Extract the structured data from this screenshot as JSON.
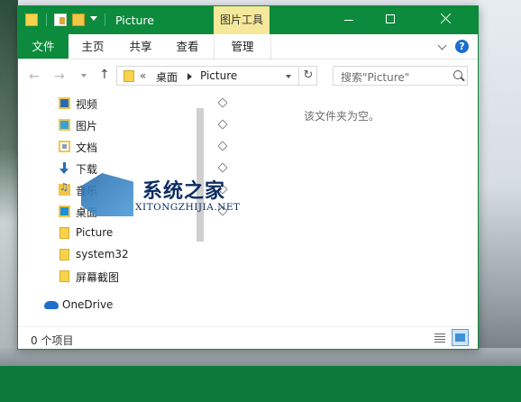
{
  "window": {
    "title": "Picture"
  },
  "ribbon": {
    "context_group": "图片工具",
    "tabs": {
      "file": "文件",
      "home": "主页",
      "share": "共享",
      "view": "查看",
      "manage": "管理"
    }
  },
  "address": {
    "overflow": "«",
    "crumbs": [
      "桌面",
      "Picture"
    ]
  },
  "search": {
    "placeholder": "搜索\"Picture\""
  },
  "nav": {
    "items": [
      {
        "label": "视频",
        "icon": "video-library-icon",
        "pinned": true
      },
      {
        "label": "图片",
        "icon": "pictures-library-icon",
        "pinned": true
      },
      {
        "label": "文档",
        "icon": "documents-library-icon",
        "pinned": true
      },
      {
        "label": "下载",
        "icon": "download-icon",
        "pinned": true
      },
      {
        "label": "音乐",
        "icon": "music-icon",
        "pinned": true
      },
      {
        "label": "桌面",
        "icon": "desktop-icon",
        "pinned": true
      },
      {
        "label": "Picture",
        "icon": "folder-icon",
        "pinned": false
      },
      {
        "label": "system32",
        "icon": "folder-icon",
        "pinned": false
      },
      {
        "label": "屏幕截图",
        "icon": "folder-icon",
        "pinned": false
      }
    ],
    "onedrive": "OneDrive"
  },
  "content": {
    "empty_message": "该文件夹为空。"
  },
  "status": {
    "item_count": "0 个项目"
  },
  "watermark": {
    "title": "系统之家",
    "subtitle": "XITONGZHIJIA.NET"
  },
  "colors": {
    "accent": "#0d8b3d",
    "context_tab": "#f6e89b",
    "taskbar": "#0d7a3b"
  }
}
